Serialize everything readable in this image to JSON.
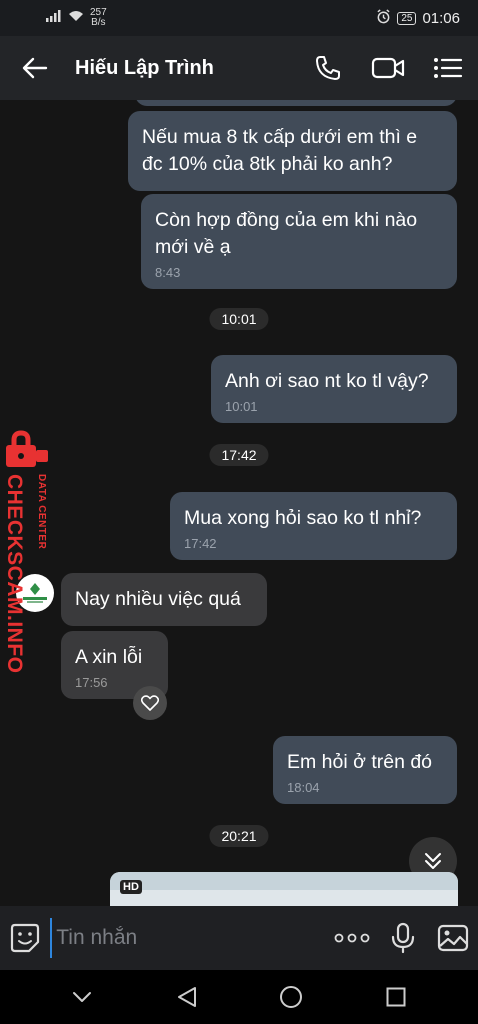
{
  "status_bar": {
    "net_speed_value": "257",
    "net_speed_unit": "B/s",
    "battery": "25",
    "time": "01:06"
  },
  "header": {
    "contact_name": "Hiếu Lập Trình",
    "icons": [
      "back-arrow-icon",
      "phone-icon",
      "video-call-icon",
      "menu-icon"
    ]
  },
  "messages": [
    {
      "direction": "out",
      "text": "Nếu mua 8 tk cấp dưới em thì e đc 10% của 8tk phải ko anh?",
      "time": ""
    },
    {
      "direction": "out",
      "text": "Còn hợp đồng của em khi nào mới về ạ",
      "time": "8:43"
    },
    {
      "direction": "out",
      "text": "Anh ơi sao nt ko tl vậy?",
      "time": "10:01"
    },
    {
      "direction": "out",
      "text": "Mua xong hỏi sao ko tl nhỉ?",
      "time": "17:42"
    },
    {
      "direction": "in",
      "text": "Nay nhiều việc quá",
      "time": ""
    },
    {
      "direction": "in",
      "text": "A xin lỗi",
      "time": "17:56"
    },
    {
      "direction": "out",
      "text": "Em hỏi ở trên đó",
      "time": "18:04"
    }
  ],
  "timestamps": [
    "10:01",
    "17:42",
    "20:21"
  ],
  "media": {
    "badge": "HD"
  },
  "watermark": {
    "main": "CHECKSCAM.INFO",
    "small": "DATA CENTER"
  },
  "input": {
    "placeholder": "Tin nhắn",
    "value": ""
  },
  "colors": {
    "outgoing_bubble": "#414b58",
    "incoming_bubble": "#3a3a3c",
    "watermark": "#e83232",
    "cursor": "#2e86de"
  }
}
